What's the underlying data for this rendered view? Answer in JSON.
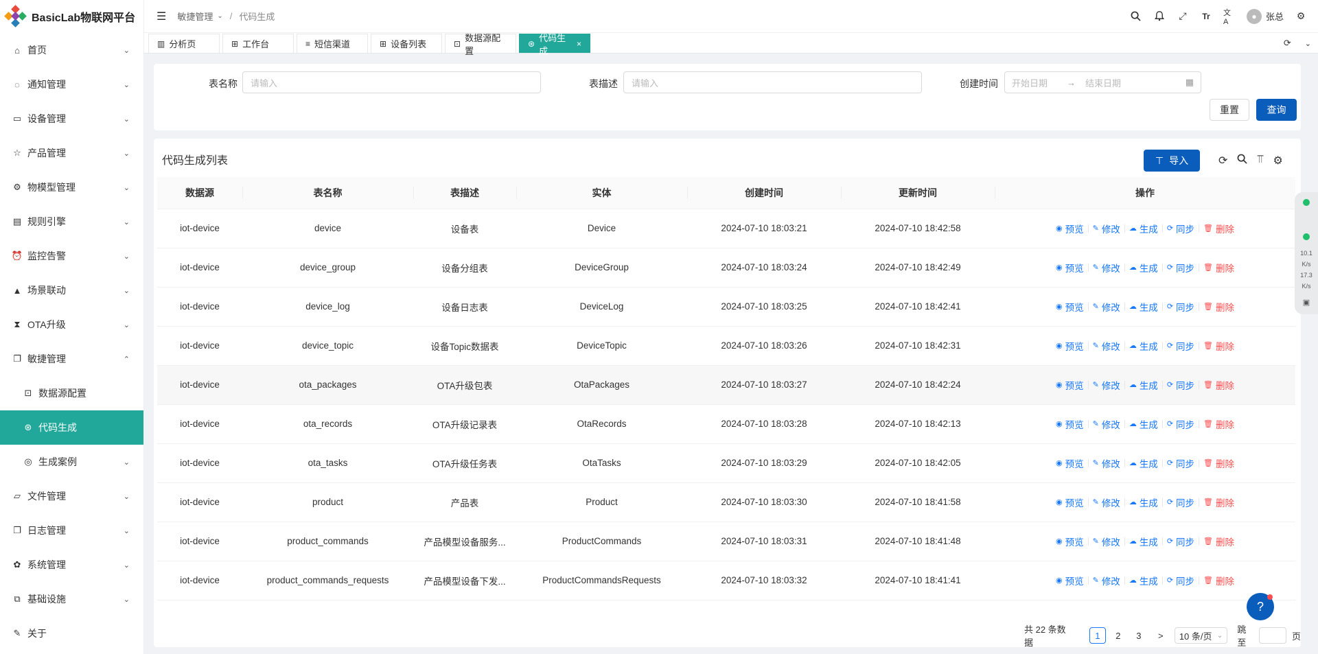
{
  "app": {
    "title": "BasicLab物联网平台"
  },
  "sidebar": {
    "items": [
      {
        "label": "首页",
        "icon": "home-icon",
        "glyph": "⌂",
        "chevron": "⌄"
      },
      {
        "label": "通知管理",
        "icon": "message-icon",
        "glyph": "◌",
        "chevron": "⌄"
      },
      {
        "label": "设备管理",
        "icon": "laptop-icon",
        "glyph": "▭",
        "chevron": "⌄"
      },
      {
        "label": "产品管理",
        "icon": "star-icon",
        "glyph": "☆",
        "chevron": "⌄"
      },
      {
        "label": "物模型管理",
        "icon": "gear-icon",
        "glyph": "⚙",
        "chevron": "⌄"
      },
      {
        "label": "规则引擎",
        "icon": "book-icon",
        "glyph": "▤",
        "chevron": "⌄"
      },
      {
        "label": "监控告警",
        "icon": "alarm-icon",
        "glyph": "⏰",
        "chevron": "⌄"
      },
      {
        "label": "场景联动",
        "icon": "triangle-icon",
        "glyph": "▲",
        "chevron": "⌄"
      },
      {
        "label": "OTA升级",
        "icon": "hourglass-icon",
        "glyph": "⧗",
        "chevron": "⌄"
      },
      {
        "label": "敏捷管理",
        "icon": "copy-icon",
        "glyph": "❐",
        "chevron": "⌃"
      },
      {
        "label": "数据源配置",
        "icon": "fund-icon",
        "glyph": "⊡",
        "chevron": ""
      },
      {
        "label": "代码生成",
        "icon": "dribbble-icon",
        "glyph": "⊛",
        "chevron": ""
      },
      {
        "label": "生成案例",
        "icon": "compass-icon",
        "glyph": "◎",
        "chevron": "⌄"
      },
      {
        "label": "文件管理",
        "icon": "folder-icon",
        "glyph": "▱",
        "chevron": "⌄"
      },
      {
        "label": "日志管理",
        "icon": "log-icon",
        "glyph": "❐",
        "chevron": "⌄"
      },
      {
        "label": "系统管理",
        "icon": "settings-icon",
        "glyph": "✿",
        "chevron": "⌄"
      },
      {
        "label": "基础设施",
        "icon": "block-icon",
        "glyph": "⧉",
        "chevron": "⌄"
      },
      {
        "label": "关于",
        "icon": "pin-icon",
        "glyph": "✎",
        "chevron": ""
      }
    ]
  },
  "header": {
    "breadcrumb_parent": "敏捷管理",
    "breadcrumb_sep": "/",
    "breadcrumb_current": "代码生成",
    "user_name": "张总",
    "font_icon": "Tr",
    "lang_icon": "文A"
  },
  "tabs": [
    {
      "label": "分析页",
      "icon": "chart-icon",
      "glyph": "▥"
    },
    {
      "label": "工作台",
      "icon": "appstore-icon",
      "glyph": "⊞"
    },
    {
      "label": "短信渠道",
      "icon": "database-icon",
      "glyph": "≡"
    },
    {
      "label": "设备列表",
      "icon": "apps-icon",
      "glyph": "⊞"
    },
    {
      "label": "数据源配置",
      "icon": "fund-icon",
      "glyph": "⊡"
    },
    {
      "label": "代码生成",
      "icon": "dribbble-icon",
      "glyph": "⊛",
      "close": "×"
    }
  ],
  "search": {
    "table_name_label": "表名称",
    "table_name_placeholder": "请输入",
    "table_desc_label": "表描述",
    "table_desc_placeholder": "请输入",
    "created_label": "创建时间",
    "start_placeholder": "开始日期",
    "end_placeholder": "结束日期",
    "reset_label": "重置",
    "query_label": "查询"
  },
  "list": {
    "title": "代码生成列表",
    "import_label": "导入",
    "columns": [
      "数据源",
      "表名称",
      "表描述",
      "实体",
      "创建时间",
      "更新时间",
      "操作"
    ],
    "actions": {
      "preview": "预览",
      "edit": "修改",
      "generate": "生成",
      "sync": "同步",
      "delete": "删除"
    },
    "rows": [
      [
        "iot-device",
        "device",
        "设备表",
        "Device",
        "2024-07-10 18:03:21",
        "2024-07-10 18:42:58"
      ],
      [
        "iot-device",
        "device_group",
        "设备分组表",
        "DeviceGroup",
        "2024-07-10 18:03:24",
        "2024-07-10 18:42:49"
      ],
      [
        "iot-device",
        "device_log",
        "设备日志表",
        "DeviceLog",
        "2024-07-10 18:03:25",
        "2024-07-10 18:42:41"
      ],
      [
        "iot-device",
        "device_topic",
        "设备Topic数据表",
        "DeviceTopic",
        "2024-07-10 18:03:26",
        "2024-07-10 18:42:31"
      ],
      [
        "iot-device",
        "ota_packages",
        "OTA升级包表",
        "OtaPackages",
        "2024-07-10 18:03:27",
        "2024-07-10 18:42:24"
      ],
      [
        "iot-device",
        "ota_records",
        "OTA升级记录表",
        "OtaRecords",
        "2024-07-10 18:03:28",
        "2024-07-10 18:42:13"
      ],
      [
        "iot-device",
        "ota_tasks",
        "OTA升级任务表",
        "OtaTasks",
        "2024-07-10 18:03:29",
        "2024-07-10 18:42:05"
      ],
      [
        "iot-device",
        "product",
        "产品表",
        "Product",
        "2024-07-10 18:03:30",
        "2024-07-10 18:41:58"
      ],
      [
        "iot-device",
        "product_commands",
        "产品模型设备服务...",
        "ProductCommands",
        "2024-07-10 18:03:31",
        "2024-07-10 18:41:48"
      ],
      [
        "iot-device",
        "product_commands_requests",
        "产品模型设备下发...",
        "ProductCommandsRequests",
        "2024-07-10 18:03:32",
        "2024-07-10 18:41:41"
      ]
    ]
  },
  "pagination": {
    "total_text": "共 22 条数据",
    "pages": [
      "1",
      "2",
      "3"
    ],
    "next": ">",
    "page_size": "10 条/页",
    "jump_label": "跳至",
    "page_suffix": "页"
  },
  "widget": {
    "up": "10.1",
    "down": "17.3",
    "unit": "K/s"
  },
  "colors": {
    "accent": "#21a89a",
    "primary": "#0b5dbb",
    "link": "#1677ff",
    "danger": "#ff4d4f"
  }
}
